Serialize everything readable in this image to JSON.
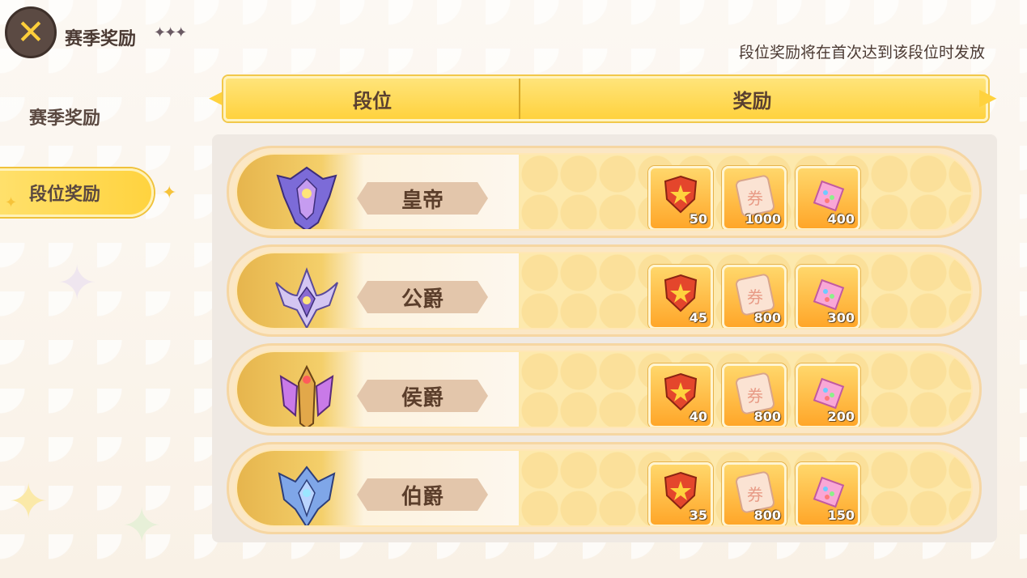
{
  "header": {
    "title": "赛季奖励",
    "title_decor": "✦✦✦",
    "notice": "段位奖励将在首次达到该段位时发放"
  },
  "sidebar": {
    "items": [
      {
        "label": "赛季奖励",
        "active": false
      },
      {
        "label": "段位奖励",
        "active": true
      }
    ]
  },
  "table": {
    "headers": {
      "rank": "段位",
      "reward": "奖励"
    },
    "rows": [
      {
        "rank": "皇帝",
        "rewards": [
          {
            "icon": "shield-star-icon",
            "qty": "50"
          },
          {
            "icon": "ticket-scroll-icon",
            "qty": "1000"
          },
          {
            "icon": "gem-box-icon",
            "qty": "400"
          }
        ]
      },
      {
        "rank": "公爵",
        "rewards": [
          {
            "icon": "shield-star-icon",
            "qty": "45"
          },
          {
            "icon": "ticket-scroll-icon",
            "qty": "800"
          },
          {
            "icon": "gem-box-icon",
            "qty": "300"
          }
        ]
      },
      {
        "rank": "侯爵",
        "rewards": [
          {
            "icon": "shield-star-icon",
            "qty": "40"
          },
          {
            "icon": "ticket-scroll-icon",
            "qty": "800"
          },
          {
            "icon": "gem-box-icon",
            "qty": "200"
          }
        ]
      },
      {
        "rank": "伯爵",
        "rewards": [
          {
            "icon": "shield-star-icon",
            "qty": "35"
          },
          {
            "icon": "ticket-scroll-icon",
            "qty": "800"
          },
          {
            "icon": "gem-box-icon",
            "qty": "150"
          }
        ]
      }
    ]
  },
  "colors": {
    "accent": "#ffd23e",
    "text": "#4b3a33",
    "rank_plate": "#e3c6ab"
  }
}
